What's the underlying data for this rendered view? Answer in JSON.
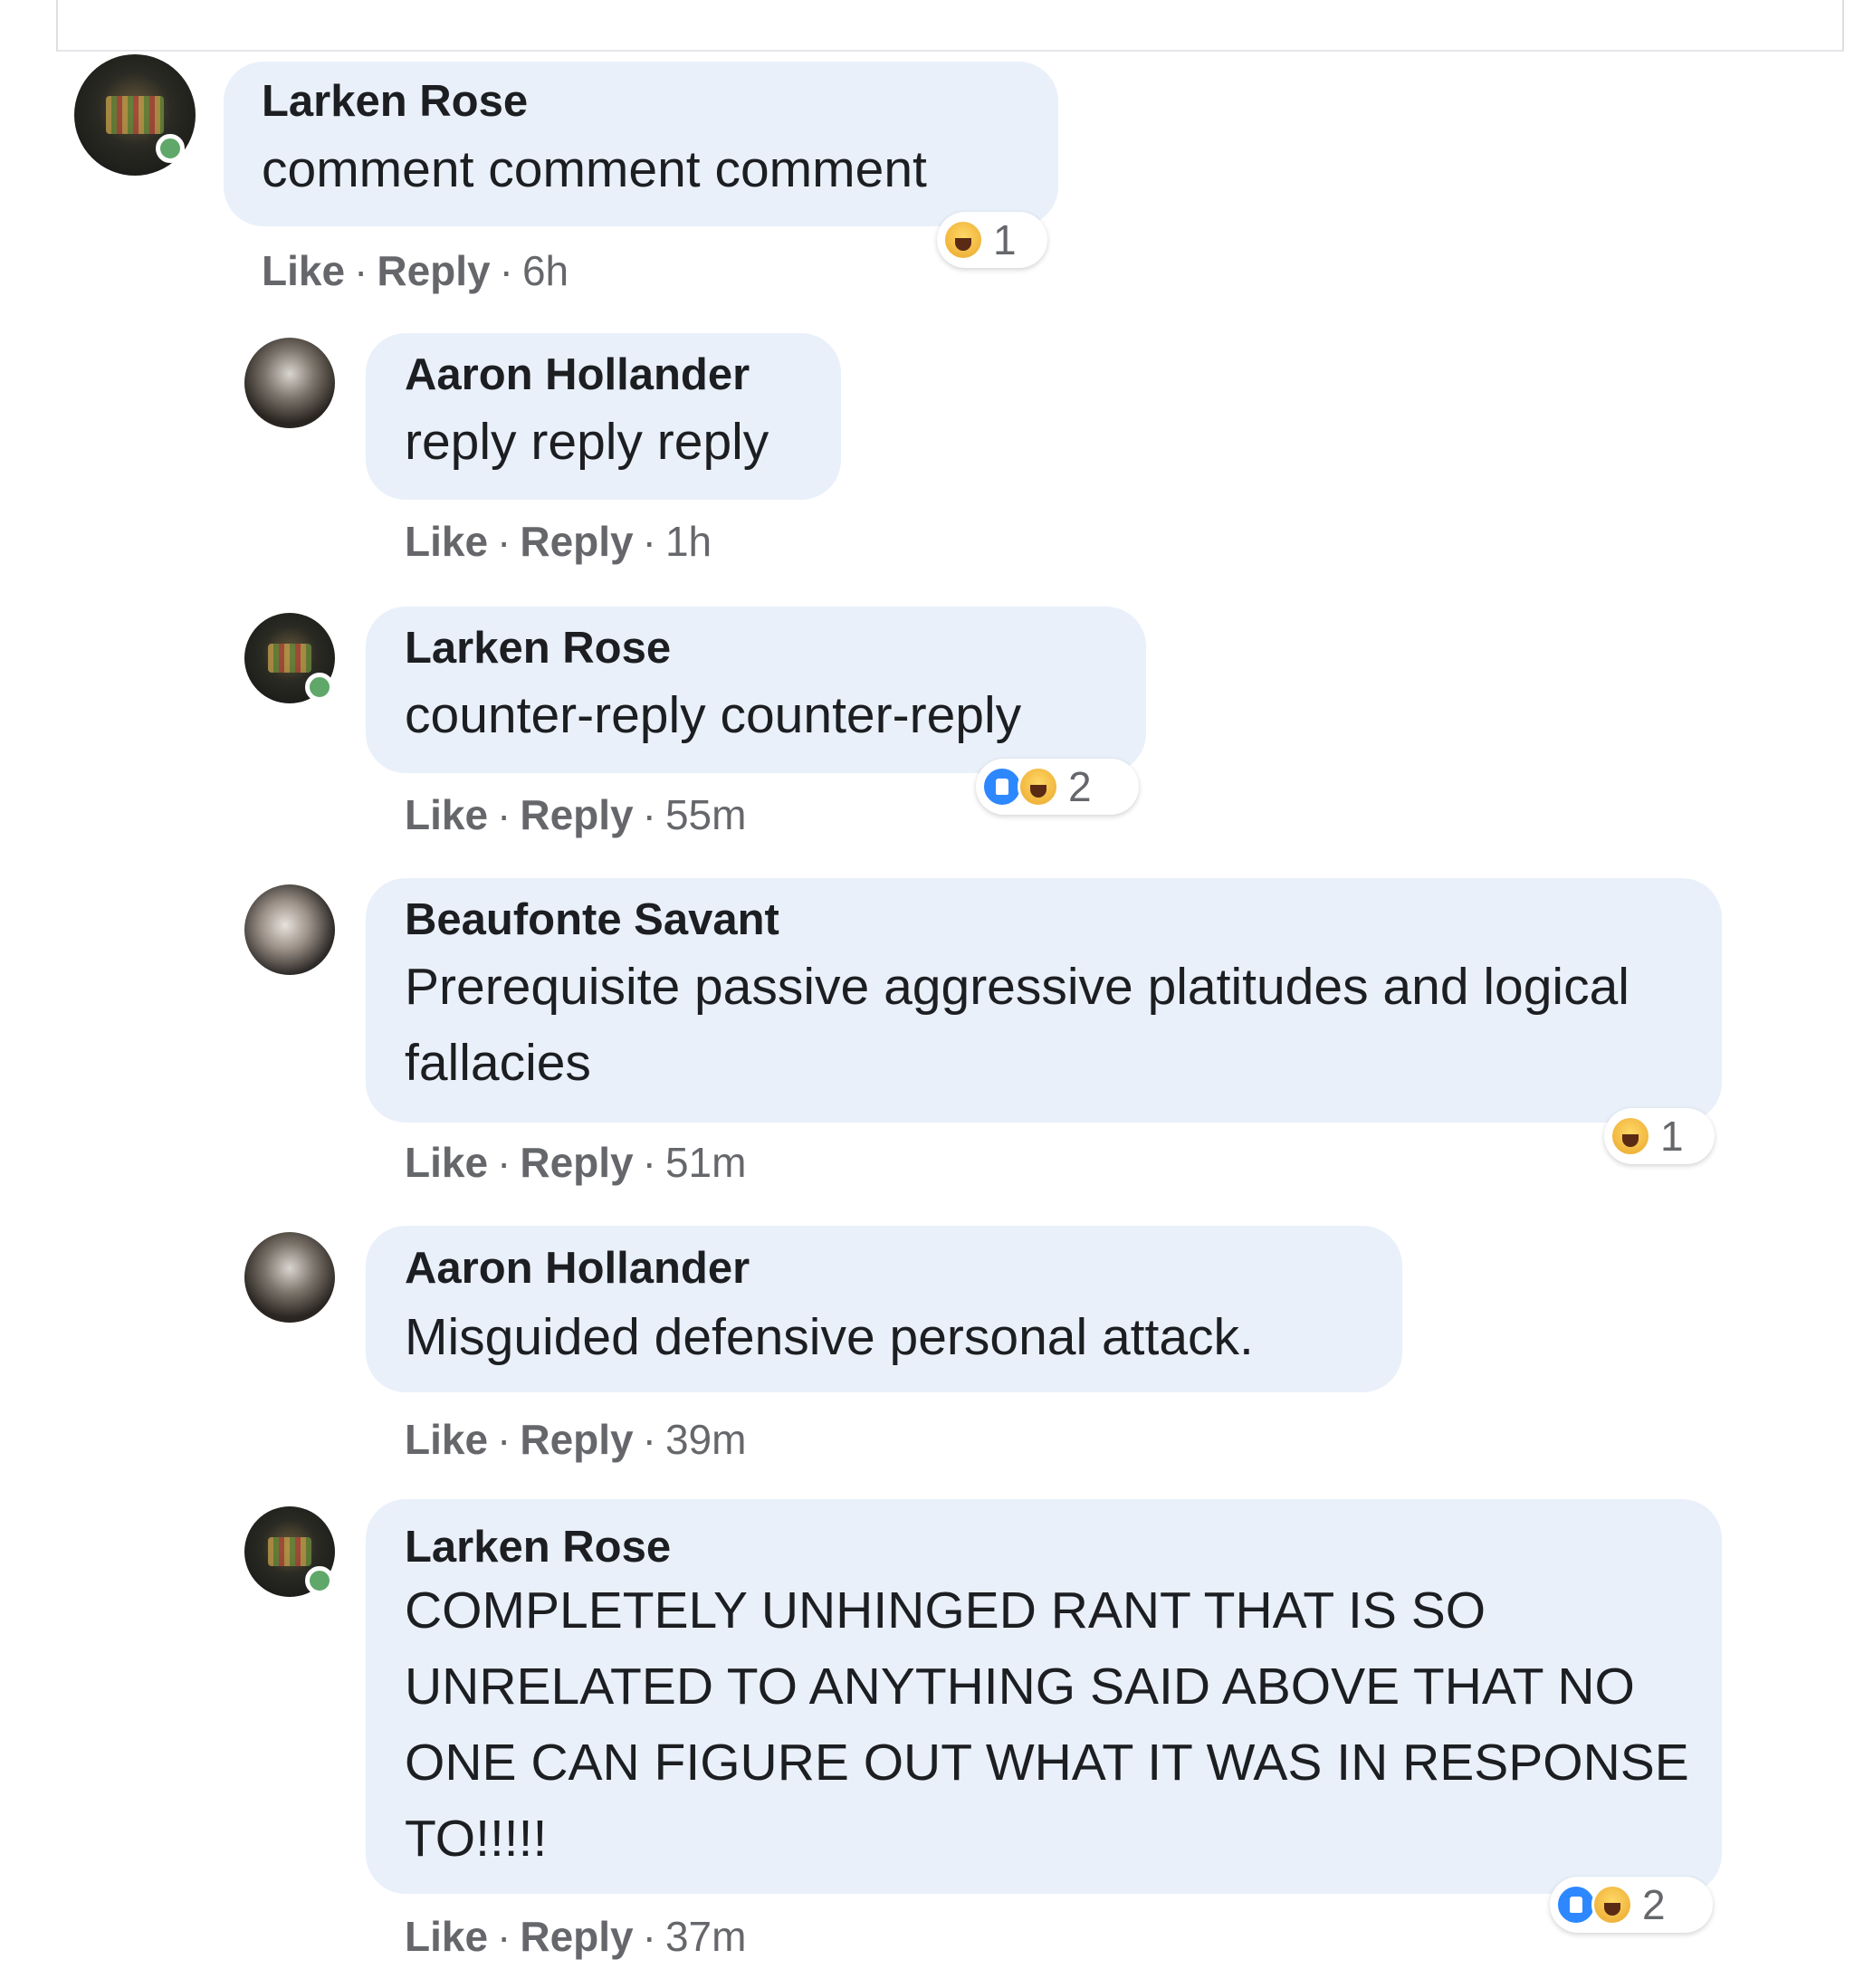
{
  "actions": {
    "like": "Like",
    "reply": "Reply",
    "separator": "·"
  },
  "comments": [
    {
      "author": "Larken Rose",
      "text": "comment comment comment",
      "time": "6h",
      "reactions": [
        "haha-icon"
      ],
      "reaction_count": "1"
    },
    {
      "author": "Aaron Hollander",
      "text": "reply reply reply",
      "time": "1h"
    },
    {
      "author": "Larken Rose",
      "text": "counter-reply counter-reply",
      "time": "55m",
      "reactions": [
        "like-icon",
        "haha-icon"
      ],
      "reaction_count": "2"
    },
    {
      "author": "Beaufonte Savant",
      "text": "Prerequisite passive aggressive platitudes and logical fallacies",
      "time": "51m",
      "reactions": [
        "haha-icon"
      ],
      "reaction_count": "1"
    },
    {
      "author": "Aaron Hollander",
      "text": "Misguided defensive personal attack.",
      "time": "39m"
    },
    {
      "author": "Larken Rose",
      "text": "COMPLETELY UNHINGED RANT THAT IS SO UNRELATED TO ANYTHING SAID ABOVE THAT NO ONE CAN FIGURE OUT WHAT IT WAS IN RESPONSE TO!!!!!",
      "time": "37m",
      "reactions": [
        "like-icon",
        "haha-icon"
      ],
      "reaction_count": "2"
    }
  ],
  "colors": {
    "bubble_bg": "#e9f0fa",
    "author_text": "#1c1e21",
    "secondary_text": "#65676b",
    "like_blue": "#2d88ff",
    "haha_yellow": "#f0b53d",
    "online_green": "#5fa86a"
  }
}
